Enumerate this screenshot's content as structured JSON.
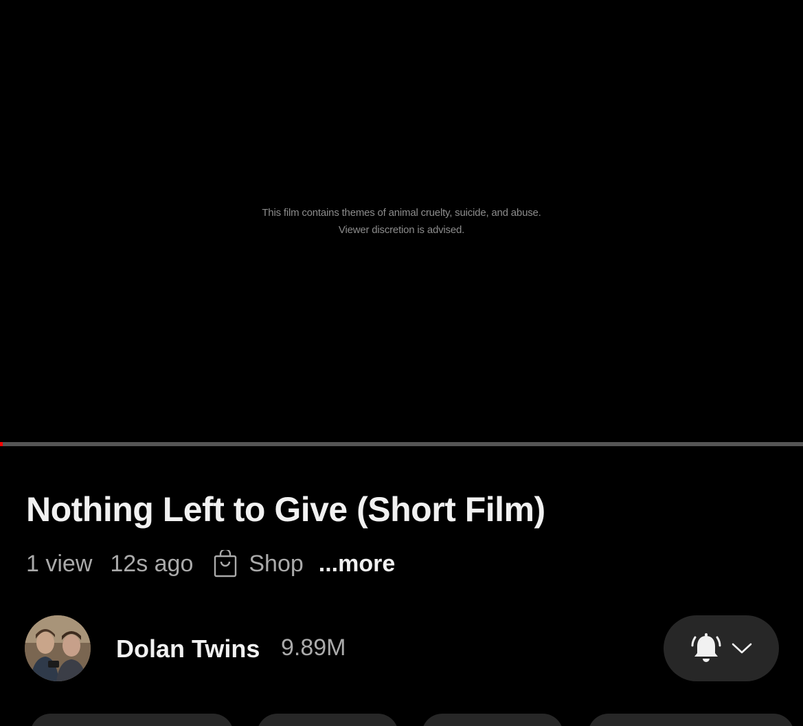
{
  "video": {
    "caption_line1": "This film contains themes of animal cruelty, suicide, and abuse.",
    "caption_line2": "Viewer discretion is advised.",
    "progress_fraction": 0.003,
    "progress_color": "#ff0000"
  },
  "title": "Nothing Left to Give (Short Film)",
  "meta": {
    "views": "1 view",
    "age": "12s ago",
    "shop_icon": "shopping-bag-icon",
    "shop_label": "Shop",
    "more_label": "...more"
  },
  "channel": {
    "name": "Dolan Twins",
    "subscribers": "9.89M",
    "avatar_icon": "channel-avatar",
    "bell_icon": "notification-bell-icon",
    "chevron_icon": "chevron-down-icon"
  },
  "colors": {
    "background": "#000000",
    "text_primary": "#f1f1f1",
    "text_secondary": "#aaaaaa",
    "pill": "#272727"
  }
}
